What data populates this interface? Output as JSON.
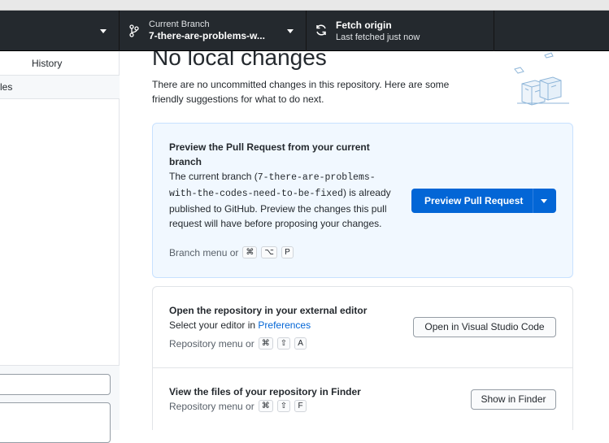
{
  "toolbar": {
    "branch_caption": "Current Branch",
    "branch_name": "7-there-are-problems-w...",
    "fetch_title": "Fetch origin",
    "fetch_status": "Last fetched just now"
  },
  "sidebar": {
    "history_tab": "History",
    "changes_partial": "les"
  },
  "main": {
    "heading": "No local changes",
    "subtext": "There are no uncommitted changes in this repository. Here are some friendly suggestions for what to do next.",
    "pr_card": {
      "title": "Preview the Pull Request from your current branch",
      "desc_prefix": "The current branch (",
      "branch_code": "7-there-are-problems-with-the-codes-need-to-be-fixed",
      "desc_suffix": ") is already published to GitHub. Preview the changes this pull request will have before proposing your changes.",
      "shortcut_label": "Branch menu or",
      "shortcut_keys": [
        "⌘",
        "⌥",
        "P"
      ],
      "button_label": "Preview Pull Request"
    },
    "editor_card": {
      "title": "Open the repository in your external editor",
      "desc_prefix": "Select your editor in",
      "desc_link": "Preferences",
      "shortcut_label": "Repository menu or",
      "shortcut_keys": [
        "⌘",
        "⇧",
        "A"
      ],
      "button_label": "Open in Visual Studio Code"
    },
    "finder_card": {
      "title": "View the files of your repository in Finder",
      "shortcut_label": "Repository menu or",
      "shortcut_keys": [
        "⌘",
        "⇧",
        "F"
      ],
      "button_label": "Show in Finder"
    }
  },
  "colors": {
    "toolbar_bg": "#24292e",
    "primary_button": "#0366d6",
    "pr_card_bg": "#f1f8ff",
    "link": "#0366d6"
  },
  "icons": [
    "chevron-down-icon",
    "git-branch-icon",
    "sync-icon",
    "empty-state-illustration"
  ]
}
